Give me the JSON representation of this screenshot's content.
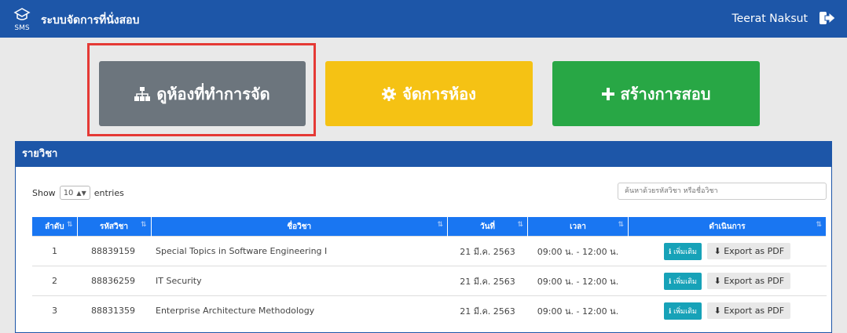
{
  "header": {
    "brand_abbr": "SMS",
    "title": "ระบบจัดการที่นั่งสอบ",
    "user_name": "Teerat Naksut"
  },
  "actions": {
    "view_rooms": "ดูห้องที่ทำการจัด",
    "manage_rooms": "จัดการห้อง",
    "create_exam": "สร้างการสอบ"
  },
  "panel": {
    "title": "รายวิชา",
    "show_label": "Show",
    "entries_value": "10",
    "entries_label": "entries",
    "search_placeholder": "ค้นหาด้วยรหัสวิชา หรือชื่อวิชา"
  },
  "table": {
    "headers": [
      "ลำดับ",
      "รหัสวิชา",
      "ชื่อวิชา",
      "วันที่",
      "เวลา",
      "ดำเนินการ"
    ],
    "rows": [
      {
        "no": "1",
        "code": "88839159",
        "name": "Special Topics in Software Engineering I",
        "date": "21 มี.ค. 2563",
        "time": "09:00 น. - 12:00 น."
      },
      {
        "no": "2",
        "code": "88836259",
        "name": "IT Security",
        "date": "21 มี.ค. 2563",
        "time": "09:00 น. - 12:00 น."
      },
      {
        "no": "3",
        "code": "88831359",
        "name": "Enterprise Architecture Methodology",
        "date": "21 มี.ค. 2563",
        "time": "09:00 น. - 12:00 น."
      }
    ],
    "more_label": "เพิ่มเติม",
    "pdf_label": "Export as PDF"
  },
  "colors": {
    "topbar": "#1d56a8",
    "table_header": "#1976f2",
    "view_button": "#6c757d",
    "manage_button": "#f5c214",
    "create_button": "#28a745",
    "highlight": "#e53935",
    "info_button": "#17a2b8"
  }
}
